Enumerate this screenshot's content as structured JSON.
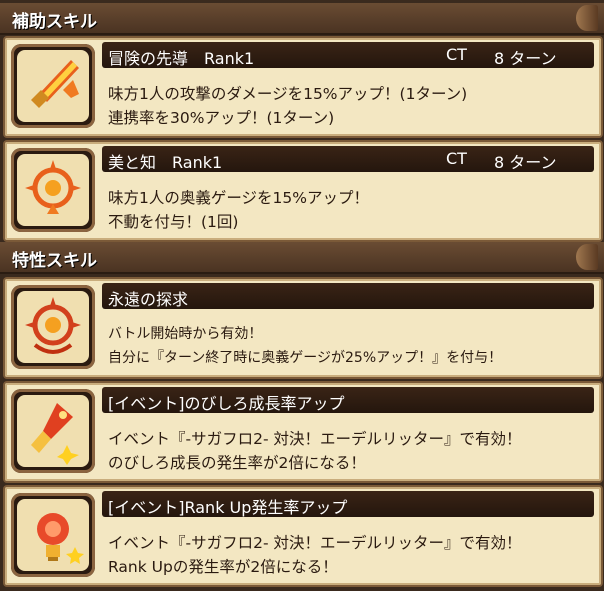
{
  "sections": [
    {
      "label": "補助スキル"
    },
    {
      "label": "特性スキル"
    }
  ],
  "support_skills": [
    {
      "title": "冒険の先導　Rank1",
      "ct_label": "CT",
      "turns": "8 ターン",
      "icon": "flaming-sword-icon",
      "lines": [
        "味方1人の攻撃のダメージを15%アップ！(1ターン)",
        "連携率を30%アップ！(1ターン)"
      ]
    },
    {
      "title": "美と知　Rank1",
      "ct_label": "CT",
      "turns": "8 ターン",
      "icon": "burst-emblem-icon",
      "lines": [
        "味方1人の奥義ゲージを15%アップ！",
        "不動を付与！(1回)"
      ]
    }
  ],
  "trait_skills": [
    {
      "title": "永遠の探求",
      "icon": "burst-emblem-red-icon",
      "lines": [
        "バトル開始時から有効！",
        "自分に『ターン終了時に奥義ゲージが25%アップ！』を付与！"
      ]
    },
    {
      "title": "[イベント]のびしろ成長率アップ",
      "icon": "rocket-spark-icon",
      "lines": [
        "イベント『-サガフロ2- 対決！エーデルリッター』で有効！",
        "のびしろ成長の発生率が2倍になる！"
      ]
    },
    {
      "title": "[イベント]Rank Up発生率アップ",
      "icon": "lightbulb-icon",
      "lines": [
        "イベント『-サガフロ2- 対決！エーデルリッター』で有効！",
        "Rank Upの発生率が2倍になる！"
      ]
    }
  ],
  "colors": {
    "card": "#f3e7c2",
    "header": "#5a3f2a",
    "titlebar": "#2a1a10"
  }
}
